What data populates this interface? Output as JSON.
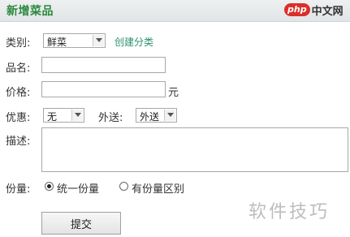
{
  "header": {
    "title": "新增菜品",
    "logo_badge": "php",
    "logo_text": "中文网"
  },
  "form": {
    "category": {
      "label": "类别:",
      "value": "鲜菜",
      "create_link": "创建分类"
    },
    "name": {
      "label": "品名:",
      "value": ""
    },
    "price": {
      "label": "价格:",
      "value": "",
      "unit": "元"
    },
    "discount": {
      "label": "优惠:",
      "value": "无"
    },
    "delivery": {
      "label": "外送:",
      "value": "外送"
    },
    "description": {
      "label": "描述:",
      "value": ""
    },
    "portion": {
      "label": "份量:",
      "options": [
        "统一份量",
        "有份量区别"
      ],
      "selected": "统一份量"
    },
    "submit_label": "提交"
  },
  "watermark": "软件技巧"
}
